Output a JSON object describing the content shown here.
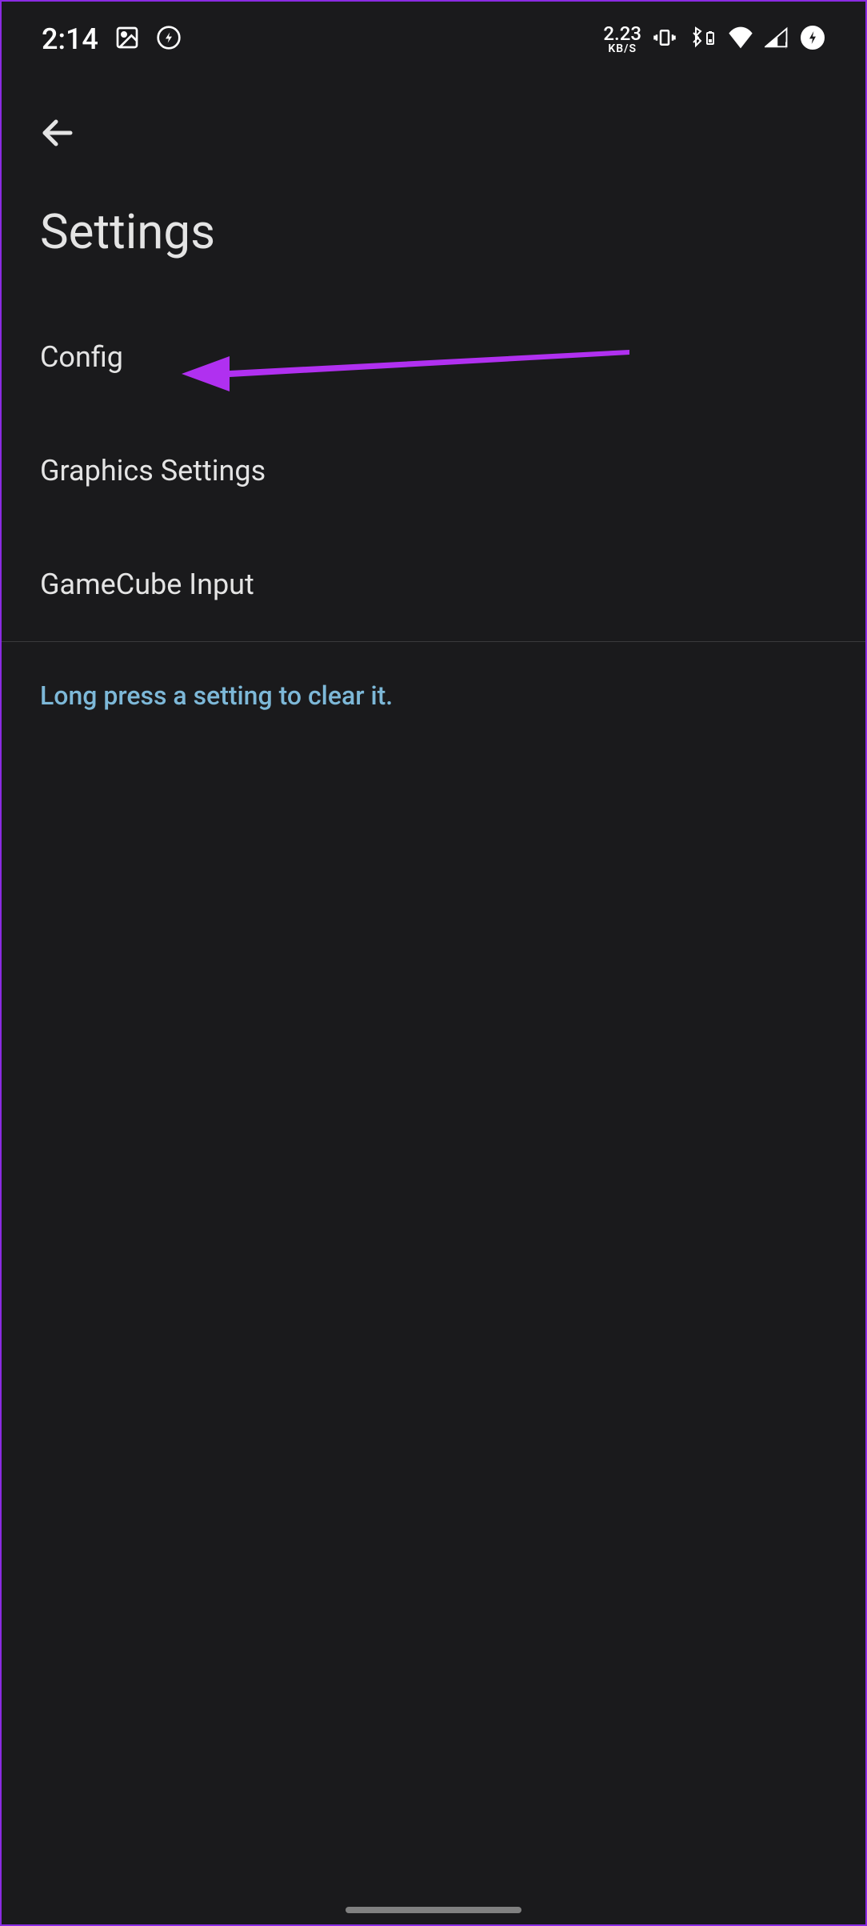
{
  "status_bar": {
    "time": "2:14",
    "kbs_value": "2.23",
    "kbs_label": "KB/S"
  },
  "header": {
    "title": "Settings"
  },
  "settings": {
    "items": [
      {
        "label": "Config"
      },
      {
        "label": "Graphics Settings"
      },
      {
        "label": "GameCube Input"
      }
    ]
  },
  "hint": {
    "text": "Long press a setting to clear it."
  },
  "annotation": {
    "arrow_color": "#b030f0"
  }
}
